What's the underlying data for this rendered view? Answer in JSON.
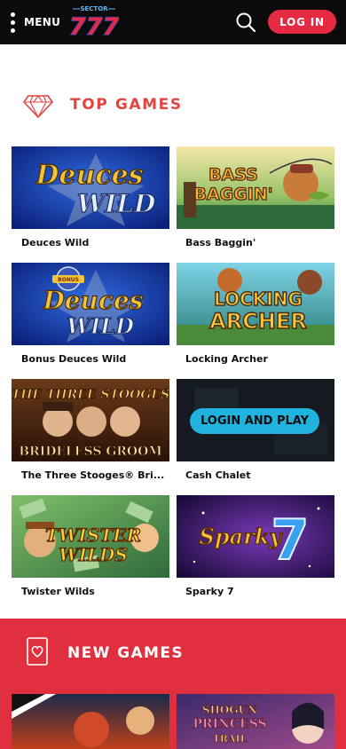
{
  "header": {
    "menu_label": "MENU",
    "login_label": "LOG IN",
    "logo_top": "SECTOR",
    "logo_number": "777",
    "search_icon": "search-icon"
  },
  "top_games": {
    "title": "TOP GAMES",
    "icon": "diamond-icon",
    "games": [
      {
        "name": "Deuces Wild",
        "art": [
          "Deuces",
          "WILD"
        ]
      },
      {
        "name": "Bass Baggin'",
        "art": [
          "BASS",
          "BAGGIN'"
        ]
      },
      {
        "name": "Bonus Deuces Wild",
        "art": [
          "BONUS",
          "Deuces",
          "WILD"
        ]
      },
      {
        "name": "Locking Archer",
        "art": [
          "LOCKING",
          "ARCHER"
        ]
      },
      {
        "name": "The Three Stooges® Bri...",
        "art": [
          "THE THREE STOOGES",
          "BRIDELESS GROOM"
        ]
      },
      {
        "name": "Cash Chalet",
        "overlay": "LOGIN AND PLAY"
      },
      {
        "name": "Twister Wilds",
        "art": [
          "TWISTER",
          "WILDS"
        ]
      },
      {
        "name": "Sparky 7",
        "art": [
          "Sparky",
          "7"
        ]
      }
    ]
  },
  "new_games": {
    "title": "NEW GAMES",
    "icon": "heart-card-icon",
    "games": [
      {
        "art": []
      },
      {
        "art": [
          "SHOGUN",
          "PRINCESS",
          "TRAIL"
        ]
      }
    ]
  },
  "colors": {
    "header_bg": "#0b0b0b",
    "accent_red": "#e62a41",
    "title_red": "#e2443f",
    "login_play_blue": "#21b3e0",
    "band_red": "#e02f3f"
  }
}
